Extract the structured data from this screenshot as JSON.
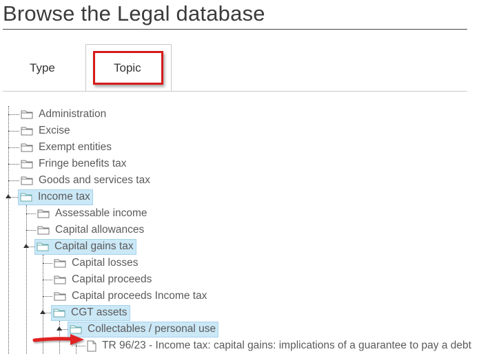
{
  "page": {
    "title": "Browse the Legal database"
  },
  "tabs": [
    {
      "label": "Type"
    },
    {
      "label": "Topic",
      "active": true
    }
  ],
  "tree": {
    "root_items": [
      {
        "label": "Administration"
      },
      {
        "label": "Excise"
      },
      {
        "label": "Exempt entities"
      },
      {
        "label": "Fringe benefits tax"
      },
      {
        "label": "Goods and services tax"
      },
      {
        "label": "Income tax",
        "expanded": true,
        "selected": true
      }
    ],
    "income_tax_children": [
      {
        "label": "Assessable income"
      },
      {
        "label": "Capital allowances"
      },
      {
        "label": "Capital gains tax",
        "expanded": true,
        "selected": true
      }
    ],
    "cgt_children": [
      {
        "label": "Capital losses"
      },
      {
        "label": "Capital proceeds"
      },
      {
        "label": "Capital proceeds Income tax"
      },
      {
        "label": "CGT assets",
        "expanded": true,
        "selected": true
      }
    ],
    "cgt_assets_children": [
      {
        "label": "Collectables / personal use",
        "expanded": true,
        "selected": true
      }
    ],
    "document": {
      "label": "TR 96/23 - Income tax: capital gains: implications of a guarantee to pay a debt"
    }
  },
  "colors": {
    "highlight_border": "#d61b1b",
    "selected_bg": "#cbe8f7",
    "arrow": "#e02020"
  },
  "icons": {
    "folder": "folder-icon",
    "document": "document-icon",
    "pointer_arrow": "arrow-right-icon"
  }
}
